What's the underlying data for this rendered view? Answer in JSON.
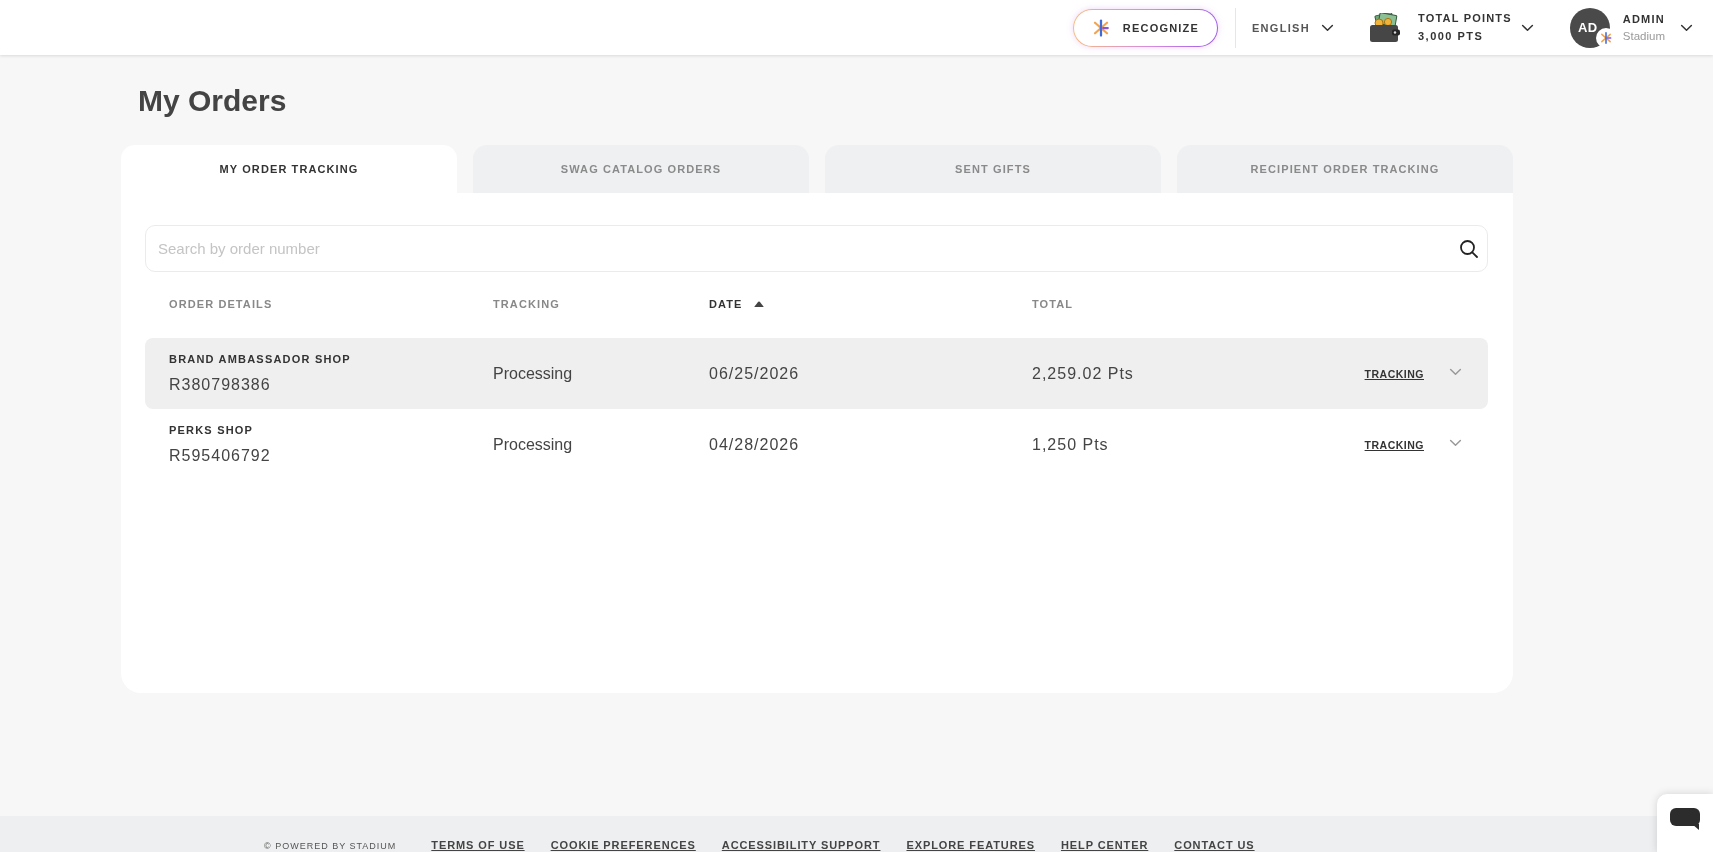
{
  "header": {
    "recognize_button": "RECOGNIZE",
    "language": "ENGLISH",
    "points": {
      "label": "TOTAL POINTS",
      "value": "3,000 PTS"
    },
    "user": {
      "initials": "AD",
      "name": "ADMIN",
      "organization": "Stadium"
    }
  },
  "page": {
    "title": "My Orders"
  },
  "tabs": [
    {
      "label": "MY ORDER TRACKING",
      "selected": true
    },
    {
      "label": "SWAG CATALOG ORDERS",
      "selected": false
    },
    {
      "label": "SENT GIFTS",
      "selected": false
    },
    {
      "label": "RECIPIENT ORDER TRACKING",
      "selected": false
    }
  ],
  "search": {
    "placeholder": "Search by order number"
  },
  "table": {
    "columns": [
      {
        "label": "ORDER DETAILS",
        "sorted": false
      },
      {
        "label": "TRACKING",
        "sorted": false
      },
      {
        "label": "DATE",
        "sorted": true
      },
      {
        "label": "TOTAL",
        "sorted": false
      }
    ],
    "rows": [
      {
        "shop": "BRAND AMBASSADOR SHOP",
        "order_number": "R380798386",
        "status": "Processing",
        "date": "06/25/2026",
        "total": "2,259.02 Pts",
        "link": "TRACKING",
        "hovered": true,
        "expanded": false
      },
      {
        "shop": "PERKS SHOP",
        "order_number": "R595406792",
        "status": "Processing",
        "date": "04/28/2026",
        "total": "1,250 Pts",
        "link": "TRACKING",
        "hovered": false,
        "expanded": false
      }
    ]
  },
  "footer": {
    "copyright": "© POWERED BY STADIUM",
    "links": [
      "TERMS OF USE",
      "COOKIE PREFERENCES",
      "ACCESSIBILITY SUPPORT",
      "EXPLORE FEATURES",
      "HELP CENTER",
      "CONTACT US"
    ]
  }
}
